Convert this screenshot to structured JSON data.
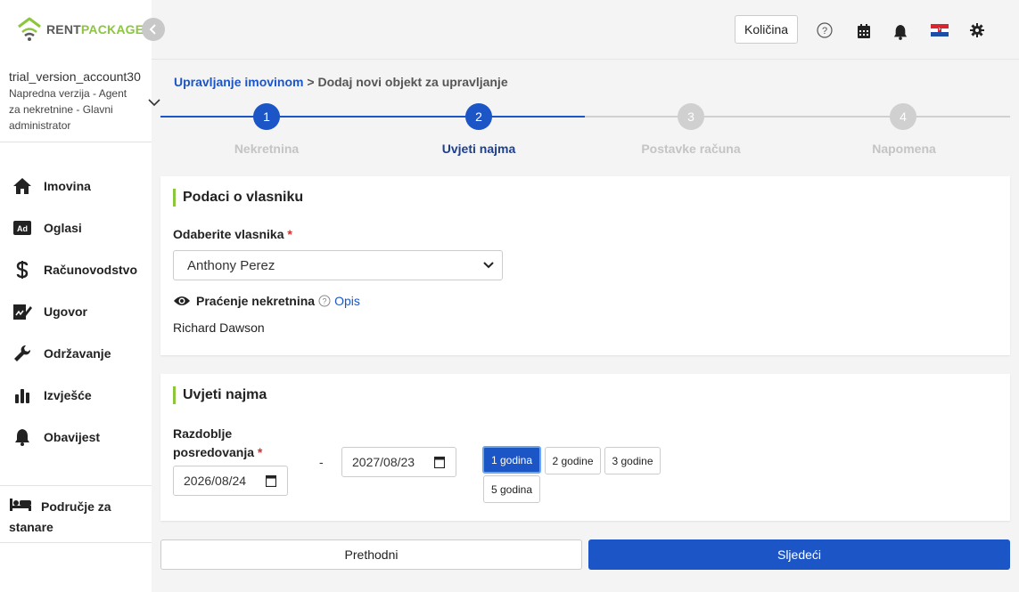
{
  "brand": {
    "rent": "RENT",
    "package": "PACKAGE"
  },
  "account": {
    "name": "trial_version_account30",
    "role": "Napredna verzija - Agent za nekretnine - Glavni administrator"
  },
  "sidebar": {
    "items": [
      {
        "label": "Imovina",
        "icon": "home-icon"
      },
      {
        "label": "Oglasi",
        "icon": "ad-icon"
      },
      {
        "label": "Računovodstvo",
        "icon": "dollar-icon"
      },
      {
        "label": "Ugovor",
        "icon": "contract-icon"
      },
      {
        "label": "Održavanje",
        "icon": "wrench-icon"
      },
      {
        "label": "Izvješće",
        "icon": "bar-chart-icon"
      },
      {
        "label": "Obavijest",
        "icon": "bell-icon"
      }
    ],
    "tenant_area": "Područje za stanare"
  },
  "header": {
    "quantity_button": "Količina",
    "icons": [
      "help-icon",
      "calendar-icon",
      "bell-icon",
      "croatia-flag-icon",
      "gear-icon"
    ]
  },
  "breadcrumb": {
    "parent": "Upravljanje imovinom",
    "separator": ">",
    "current": "Dodaj novi objekt za upravljanje"
  },
  "stepper": {
    "steps": [
      {
        "number": "1",
        "label": "Nekretnina",
        "state": "done"
      },
      {
        "number": "2",
        "label": "Uvjeti najma",
        "state": "active"
      },
      {
        "number": "3",
        "label": "Postavke računa",
        "state": "pending"
      },
      {
        "number": "4",
        "label": "Napomena",
        "state": "pending"
      }
    ]
  },
  "owner_card": {
    "title": "Podaci o vlasniku",
    "select_label": "Odaberite vlasnika",
    "required_mark": "*",
    "selected_owner": "Anthony Perez",
    "tracking_label": "Praćenje nekretnina",
    "description_link": "Opis",
    "tracker_name": "Richard Dawson"
  },
  "lease_card": {
    "title": "Uvjeti najma",
    "period_label_line1": "Razdoblje",
    "period_label_line2": "posredovanja",
    "required_mark": "*",
    "start_date": "2026/08/24",
    "range_separator": "-",
    "end_date": "2027/08/23",
    "durations": [
      "1 godina",
      "2 godine",
      "3 godine",
      "5 godina"
    ],
    "selected_duration": "1 godina"
  },
  "footer": {
    "prev_label": "Prethodni",
    "next_label": "Sljedeći"
  },
  "colors": {
    "primary": "#1c55c5",
    "accent_green": "#8cc63f",
    "inactive_step": "#d0d0d0"
  }
}
